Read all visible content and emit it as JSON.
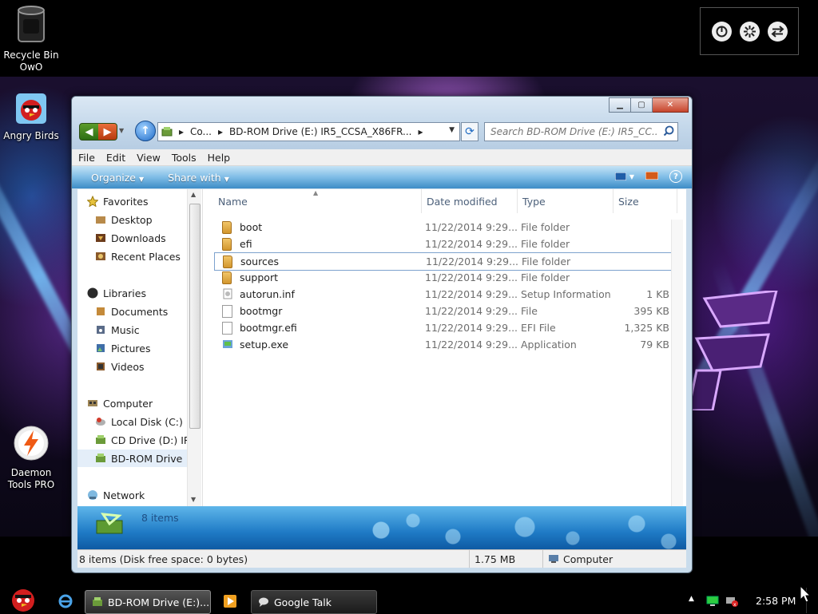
{
  "desktop": {
    "icons": [
      {
        "label_line1": "Recycle Bin",
        "label_line2": "OwO"
      },
      {
        "label_line1": "Angry Birds",
        "label_line2": ""
      },
      {
        "label_line1": "Daemon",
        "label_line2": "Tools PRO"
      }
    ]
  },
  "window": {
    "address": {
      "seg1": "Co...",
      "seg2": "BD-ROM Drive (E:) IR5_CCSA_X86FR..."
    },
    "search": {
      "placeholder": "Search BD-ROM Drive (E:) IR5_CC..."
    },
    "menu": [
      "File",
      "Edit",
      "View",
      "Tools",
      "Help"
    ],
    "toolbar": {
      "organize": "Organize",
      "share_with": "Share with"
    },
    "nav": {
      "favorites": "Favorites",
      "desktop": "Desktop",
      "downloads": "Downloads",
      "recent_places": "Recent Places",
      "libraries": "Libraries",
      "documents": "Documents",
      "music": "Music",
      "pictures": "Pictures",
      "videos": "Videos",
      "computer": "Computer",
      "local_disk": "Local Disk (C:)",
      "cd_drive": "CD Drive (D:) IR",
      "bd_rom": "BD-ROM Drive",
      "network": "Network"
    },
    "columns": {
      "name": "Name",
      "date": "Date modified",
      "type": "Type",
      "size": "Size"
    },
    "files": [
      {
        "name": "boot",
        "date": "11/22/2014 9:29...",
        "type": "File folder",
        "size": "",
        "kind": "folder"
      },
      {
        "name": "efi",
        "date": "11/22/2014 9:29...",
        "type": "File folder",
        "size": "",
        "kind": "folder"
      },
      {
        "name": "sources",
        "date": "11/22/2014 9:29...",
        "type": "File folder",
        "size": "",
        "kind": "folder"
      },
      {
        "name": "support",
        "date": "11/22/2014 9:29...",
        "type": "File folder",
        "size": "",
        "kind": "folder"
      },
      {
        "name": "autorun.inf",
        "date": "11/22/2014 9:29...",
        "type": "Setup Information",
        "size": "1 KB",
        "kind": "inf"
      },
      {
        "name": "bootmgr",
        "date": "11/22/2014 9:29...",
        "type": "File",
        "size": "395 KB",
        "kind": "file"
      },
      {
        "name": "bootmgr.efi",
        "date": "11/22/2014 9:29...",
        "type": "EFI File",
        "size": "1,325 KB",
        "kind": "file"
      },
      {
        "name": "setup.exe",
        "date": "11/22/2014 9:29...",
        "type": "Application",
        "size": "79 KB",
        "kind": "exe"
      }
    ],
    "details": {
      "count": "8 items"
    },
    "status": {
      "items": "8 items (Disk free space: 0 bytes)",
      "size": "1.75 MB",
      "location": "Computer"
    }
  },
  "taskbar": {
    "explorer_button": "BD-ROM Drive (E:)...",
    "gtalk_button": "Google Talk",
    "clock": "2:58 PM"
  }
}
